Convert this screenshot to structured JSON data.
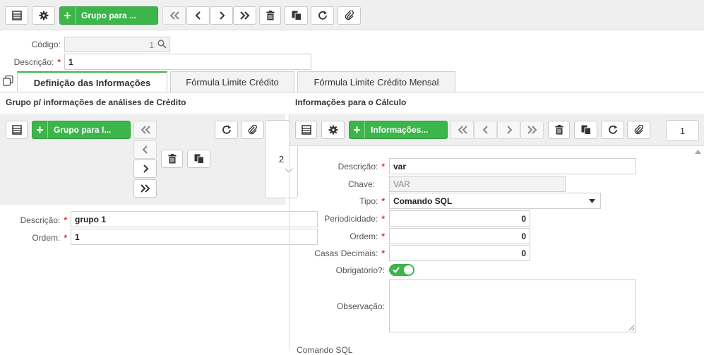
{
  "toolbar": {
    "group_button_label": "Grupo para ..."
  },
  "header": {
    "codigo_label": "Código:",
    "codigo_value": "1",
    "descricao_label": "Descrição:",
    "descricao_value": "1"
  },
  "tabs": [
    {
      "label": "Definição das Informações",
      "active": true
    },
    {
      "label": "Fórmula Limite Crédito",
      "active": false
    },
    {
      "label": "Fórmula Limite Crédito Mensal",
      "active": false
    }
  ],
  "left_panel": {
    "title": "Grupo p/ informações de análises de Crédito",
    "add_button_label": "Grupo para I...",
    "page_number": "2",
    "descricao_label": "Descrição:",
    "descricao_value": "grupo 1",
    "ordem_label": "Ordem:",
    "ordem_value": "1"
  },
  "right_panel": {
    "title": "Informações para o Cálculo",
    "add_button_label": "Informações...",
    "page_number": "1",
    "fields": {
      "descricao_label": "Descrição:",
      "descricao_value": "var",
      "chave_label": "Chave:",
      "chave_value": "VAR",
      "tipo_label": "Tipo:",
      "tipo_value": "Comando SQL",
      "periodicidade_label": "Periodicidade:",
      "periodicidade_value": "0",
      "ordem_label": "Ordem:",
      "ordem_value": "0",
      "casas_label": "Casas Decimais:",
      "casas_value": "0",
      "obrigatorio_label": "Obrigatório?:",
      "obrigatorio_value": true,
      "observacao_label": "Observação:",
      "observacao_value": "",
      "comando_label": "Comando SQL"
    }
  },
  "colors": {
    "accent_green": "#3cb54a",
    "required_red": "#d9342b",
    "toolbar_bg": "#efefef"
  }
}
